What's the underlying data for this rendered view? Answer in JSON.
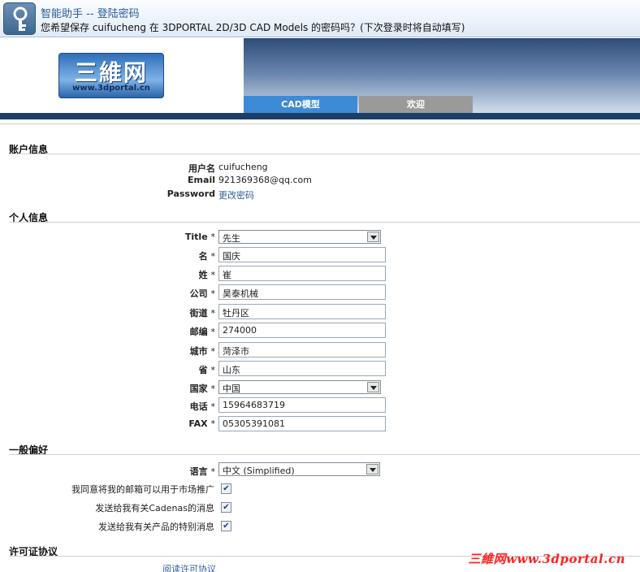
{
  "password_helper": {
    "title": "智能助手 -- 登陆密码",
    "message": "您希望保存 cuifucheng 在 3DPORTAL 2D/3D CAD Models 的密码吗？(下次登录时将自动填写)"
  },
  "header": {
    "logo_text": "三維网",
    "logo_url": "www.3dportal.cn",
    "tabs": [
      {
        "label": "CAD模型",
        "active": true
      },
      {
        "label": "欢迎",
        "active": false
      }
    ]
  },
  "account": {
    "section_title": "账户信息",
    "username_label": "用户名",
    "username": "cuifucheng",
    "email_label": "Email",
    "email": "921369368@qq.com",
    "password_label": "Password",
    "password_link": "更改密码"
  },
  "personal": {
    "section_title": "个人信息",
    "required_mark": "*",
    "fields": {
      "title": {
        "label": "Title",
        "value": "先生"
      },
      "first_name": {
        "label": "名",
        "value": "国庆"
      },
      "last_name": {
        "label": "姓",
        "value": "崔"
      },
      "company": {
        "label": "公司",
        "value": "昊泰机械"
      },
      "street": {
        "label": "街道",
        "value": "牡丹区"
      },
      "zip": {
        "label": "邮编",
        "value": "274000"
      },
      "city": {
        "label": "城市",
        "value": "菏泽市"
      },
      "province": {
        "label": "省",
        "value": "山东"
      },
      "country": {
        "label": "国家",
        "value": "中国"
      },
      "phone": {
        "label": "电话",
        "value": "15964683719"
      },
      "fax": {
        "label": "FAX",
        "value": "05305391081"
      }
    }
  },
  "preferences": {
    "section_title": "一般偏好",
    "language_label": "语言",
    "language_value": "中文 (Simplified)",
    "checkboxes": [
      {
        "label": "我同意将我的邮箱可以用于市场推广",
        "checked": true
      },
      {
        "label": "发送给我有关Cadenas的消息",
        "checked": true
      },
      {
        "label": "发送给我有关产品的特别消息",
        "checked": true
      }
    ]
  },
  "license": {
    "section_title": "许可证协议",
    "link": "阅读许可协议"
  },
  "watermark": "三維网www.3dportal.cn",
  "colors": {
    "accent": "#3d8ad6",
    "header_dark": "#1b3f68",
    "link": "#335f9a",
    "watermark": "#ff2020"
  }
}
